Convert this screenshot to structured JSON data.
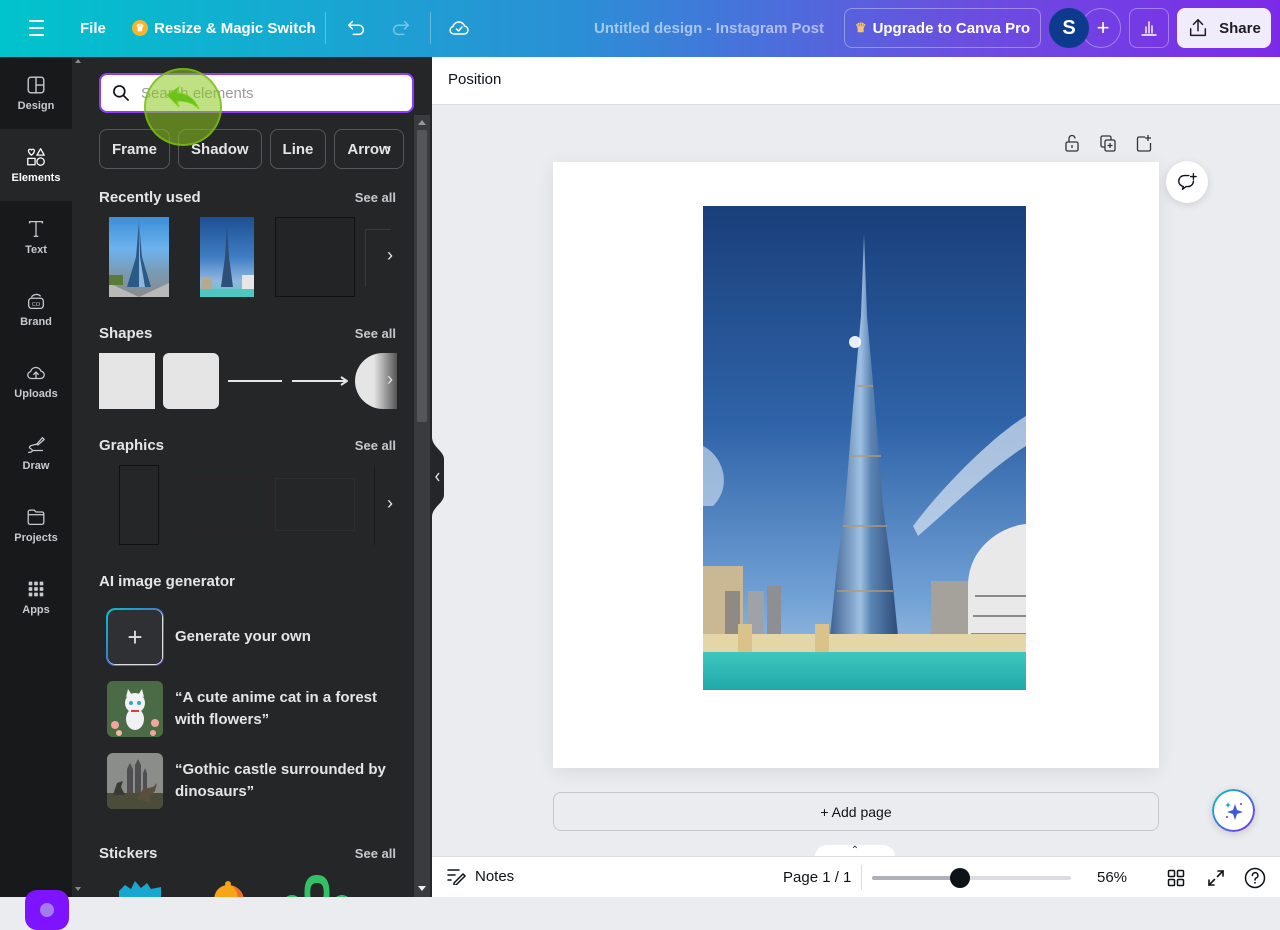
{
  "topbar": {
    "file_label": "File",
    "resize_label": "Resize & Magic Switch",
    "design_title": "Untitled design - Instagram Post",
    "upgrade_label": "Upgrade to Canva Pro",
    "avatar_initial": "S",
    "add_member_label": "+",
    "share_label": "Share",
    "gradient_colors": [
      "#00c4cc",
      "#2b8fd6",
      "#6a4fe0",
      "#7d2ae8"
    ]
  },
  "rail": {
    "items": [
      {
        "label": "Design",
        "icon": "layout-icon"
      },
      {
        "label": "Elements",
        "icon": "shapes-icon",
        "active": true
      },
      {
        "label": "Text",
        "icon": "text-icon"
      },
      {
        "label": "Brand",
        "icon": "brand-icon"
      },
      {
        "label": "Uploads",
        "icon": "cloud-upload-icon"
      },
      {
        "label": "Draw",
        "icon": "draw-icon"
      },
      {
        "label": "Projects",
        "icon": "folder-icon"
      },
      {
        "label": "Apps",
        "icon": "apps-grid-icon"
      }
    ],
    "accent_color": "#7d13ff"
  },
  "panel": {
    "search_placeholder": "Search elements",
    "search_value": "",
    "chips": [
      "Frame",
      "Shadow",
      "Line",
      "Arrow"
    ],
    "sections": {
      "recently_used": {
        "title": "Recently used",
        "see_all": "See all"
      },
      "shapes": {
        "title": "Shapes",
        "see_all": "See all"
      },
      "graphics": {
        "title": "Graphics",
        "see_all": "See all"
      },
      "ai_generator": {
        "title": "AI image generator",
        "generate_label": "Generate your own",
        "prompts": [
          "“A cute anime cat in a forest with flowers”",
          "“Gothic castle surrounded by dinosaurs”"
        ]
      },
      "stickers": {
        "title": "Stickers",
        "see_all": "See all"
      }
    }
  },
  "editor": {
    "context_label": "Position",
    "add_page_label": "+ Add page",
    "image_subject": "Burj Khalifa tower photo"
  },
  "bottombar": {
    "notes_label": "Notes",
    "page_indicator": "Page 1 / 1",
    "zoom_percent_label": "56%",
    "zoom_slider_fraction": 0.44
  }
}
